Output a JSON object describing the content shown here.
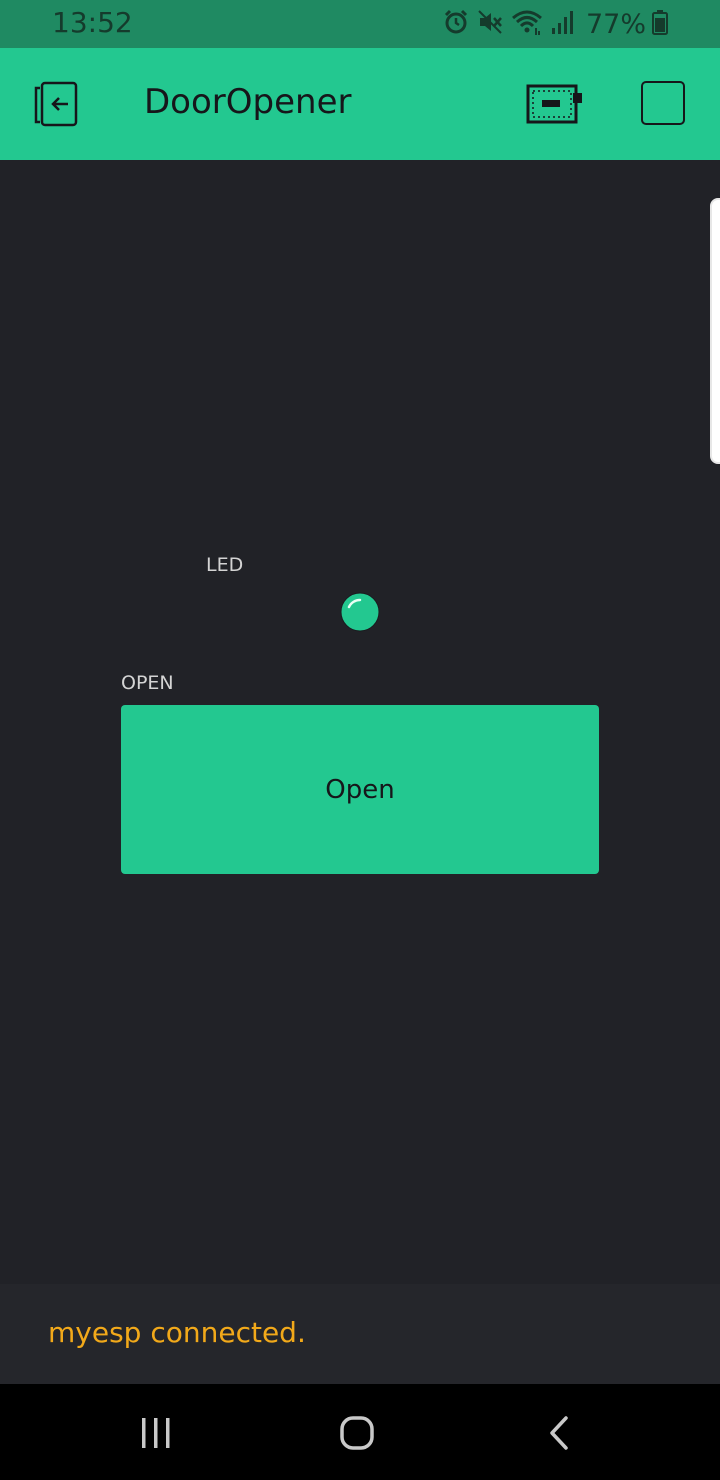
{
  "status_bar": {
    "time": "13:52",
    "battery": "77%",
    "icons": [
      "alarm-icon",
      "mute-icon",
      "wifi-icon",
      "signal-icon",
      "battery-icon"
    ]
  },
  "app_bar": {
    "title": "DoorOpener",
    "icons": [
      "exit-icon",
      "device-icon",
      "stop-icon"
    ]
  },
  "widgets": {
    "led": {
      "label": "LED",
      "color": "#23c890"
    },
    "button": {
      "label": "OPEN",
      "text": "Open",
      "color": "#23c890"
    }
  },
  "notification": {
    "text": "myesp connected.",
    "color": "#f2a91a"
  },
  "nav": {
    "icons": [
      "recent-apps-icon",
      "home-icon",
      "back-icon"
    ]
  },
  "colors": {
    "accent": "#23c890",
    "background": "#212227",
    "status_bar": "#1f8a62"
  }
}
